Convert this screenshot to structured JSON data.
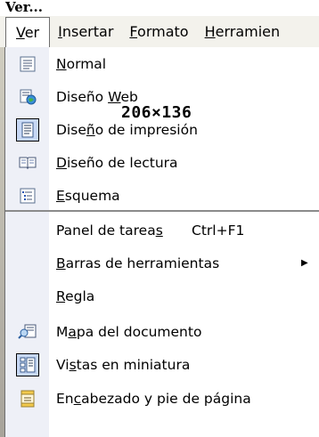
{
  "title_overlay": "Ver...",
  "menubar": {
    "items": [
      {
        "pre": "",
        "u": "V",
        "post": "er"
      },
      {
        "pre": "",
        "u": "I",
        "post": "nsertar"
      },
      {
        "pre": "",
        "u": "F",
        "post": "ormato"
      },
      {
        "pre": "",
        "u": "H",
        "post": "erramien"
      }
    ]
  },
  "size_label": "206×136",
  "menu": {
    "items": [
      {
        "pre": "",
        "u": "N",
        "post": "ormal",
        "shortcut": "",
        "icon": "normal-view-icon"
      },
      {
        "pre": "Diseño ",
        "u": "W",
        "post": "eb",
        "shortcut": "",
        "icon": "web-layout-icon"
      },
      {
        "pre": "Dise",
        "u": "ñ",
        "post": "o de impresión",
        "shortcut": "",
        "icon": "print-layout-icon"
      },
      {
        "pre": "",
        "u": "D",
        "post": "iseño de lectura",
        "shortcut": "",
        "icon": "reading-layout-icon"
      },
      {
        "pre": "",
        "u": "E",
        "post": "squema",
        "shortcut": "",
        "icon": "outline-icon"
      },
      {
        "pre": "Panel de tarea",
        "u": "s",
        "post": "",
        "shortcut": "Ctrl+F1",
        "icon": ""
      },
      {
        "pre": "",
        "u": "B",
        "post": "arras de herramientas",
        "shortcut": "",
        "icon": ""
      },
      {
        "pre": "",
        "u": "R",
        "post": "egla",
        "shortcut": "",
        "icon": ""
      },
      {
        "pre": "M",
        "u": "a",
        "post": "pa del documento",
        "shortcut": "",
        "icon": "document-map-icon"
      },
      {
        "pre": "Vi",
        "u": "s",
        "post": "tas en miniatura",
        "shortcut": "",
        "icon": "thumbnails-icon"
      },
      {
        "pre": "En",
        "u": "c",
        "post": "abezado y pie de página",
        "shortcut": "",
        "icon": "header-footer-icon"
      }
    ]
  }
}
